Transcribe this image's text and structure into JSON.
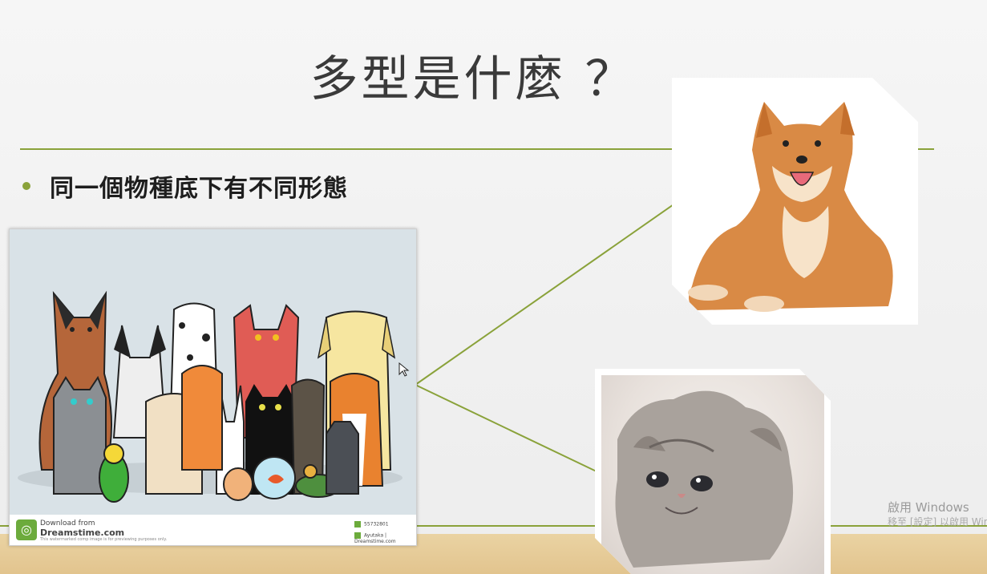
{
  "slide": {
    "title": "多型是什麼 ？",
    "bullet": "同一個物種底下有不同形態"
  },
  "stock_image": {
    "brand_top": "Download from",
    "brand_name": "Dreamstime.com",
    "note": "This watermarked comp image is for previewing purposes only.",
    "id": "55732801",
    "credit": "Ayutaka | Dreamstime.com"
  },
  "watermark": {
    "line1": "啟用 Windows",
    "line2": "移至 [設定] 以啟用 Windows"
  },
  "colors": {
    "accent": "#8aa23a",
    "floor": "#e2c48e",
    "panel": "#d9e2e7"
  }
}
